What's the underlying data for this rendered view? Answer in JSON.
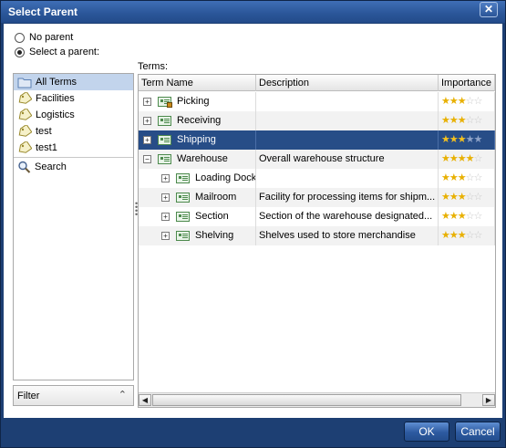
{
  "dialog": {
    "title": "Select Parent",
    "close_glyph": "✕"
  },
  "options": {
    "no_parent": {
      "label": "No parent",
      "checked": false
    },
    "select_parent": {
      "label": "Select a parent:",
      "checked": true
    }
  },
  "left_panel": {
    "items": [
      {
        "label": "All Terms",
        "icon": "folder-icon",
        "selected": true
      },
      {
        "label": "Facilities",
        "icon": "tag-icon"
      },
      {
        "label": "Logistics",
        "icon": "tag-icon"
      },
      {
        "label": "test",
        "icon": "tag-icon"
      },
      {
        "label": "test1",
        "icon": "tag-icon"
      }
    ],
    "search_label": "Search",
    "filter_label": "Filter"
  },
  "terms": {
    "label": "Terms:",
    "columns": {
      "name": "Term Name",
      "description": "Description",
      "importance": "Importance"
    },
    "rows": [
      {
        "name": "Picking",
        "description": "",
        "importance": 3,
        "max": 5,
        "indent": 0,
        "expander": "+",
        "locked": true
      },
      {
        "name": "Receiving",
        "description": "",
        "importance": 3,
        "max": 5,
        "indent": 0,
        "expander": "+"
      },
      {
        "name": "Shipping",
        "description": "",
        "importance": 3,
        "max": 5,
        "indent": 0,
        "expander": "+",
        "selected": true
      },
      {
        "name": "Warehouse",
        "description": "Overall warehouse structure",
        "importance": 4,
        "max": 5,
        "indent": 0,
        "expander": "−"
      },
      {
        "name": "Loading Dock",
        "description": "",
        "importance": 3,
        "max": 5,
        "indent": 1,
        "expander": "+"
      },
      {
        "name": "Mailroom",
        "description": "Facility for processing items for shipm...",
        "importance": 3,
        "max": 5,
        "indent": 1,
        "expander": "+"
      },
      {
        "name": "Section",
        "description": "Section of the warehouse designated...",
        "importance": 3,
        "max": 5,
        "indent": 1,
        "expander": "+"
      },
      {
        "name": "Shelving",
        "description": "Shelves used to store merchandise",
        "importance": 3,
        "max": 5,
        "indent": 1,
        "expander": "+"
      }
    ]
  },
  "buttons": {
    "ok": "OK",
    "cancel": "Cancel"
  },
  "colors": {
    "accent": "#274d87",
    "title_bar": "#2a5598",
    "star": "#e8b000"
  }
}
